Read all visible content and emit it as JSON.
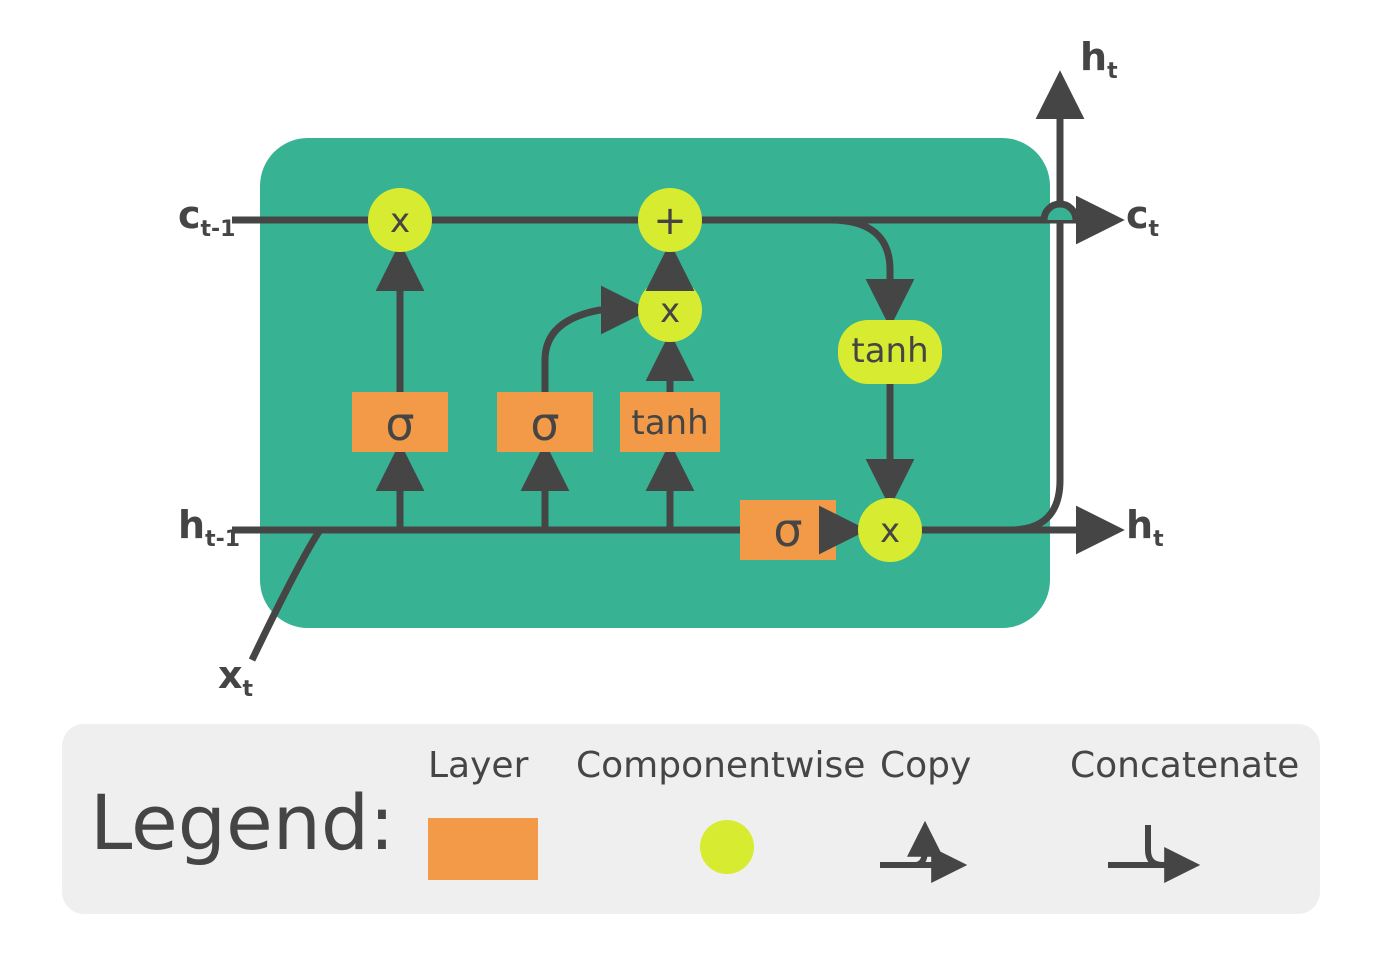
{
  "io": {
    "c_prev": "c",
    "c_prev_sub": "t-1",
    "h_prev": "h",
    "h_prev_sub": "t-1",
    "x_in": "x",
    "x_in_sub": "t",
    "c_out": "c",
    "c_out_sub": "t",
    "h_out": "h",
    "h_out_sub": "t",
    "h_top": "h",
    "h_top_sub": "t"
  },
  "gates": {
    "sigma1": "σ",
    "sigma2": "σ",
    "tanh_in": "tanh",
    "sigma3": "σ",
    "tanh_out": "tanh"
  },
  "ops": {
    "mult1": "x",
    "add": "+",
    "mult2": "x",
    "mult3": "x"
  },
  "legend": {
    "title": "Legend:",
    "layer": "Layer",
    "componentwise": "Componentwise",
    "copy": "Copy",
    "concat": "Concatenate"
  }
}
